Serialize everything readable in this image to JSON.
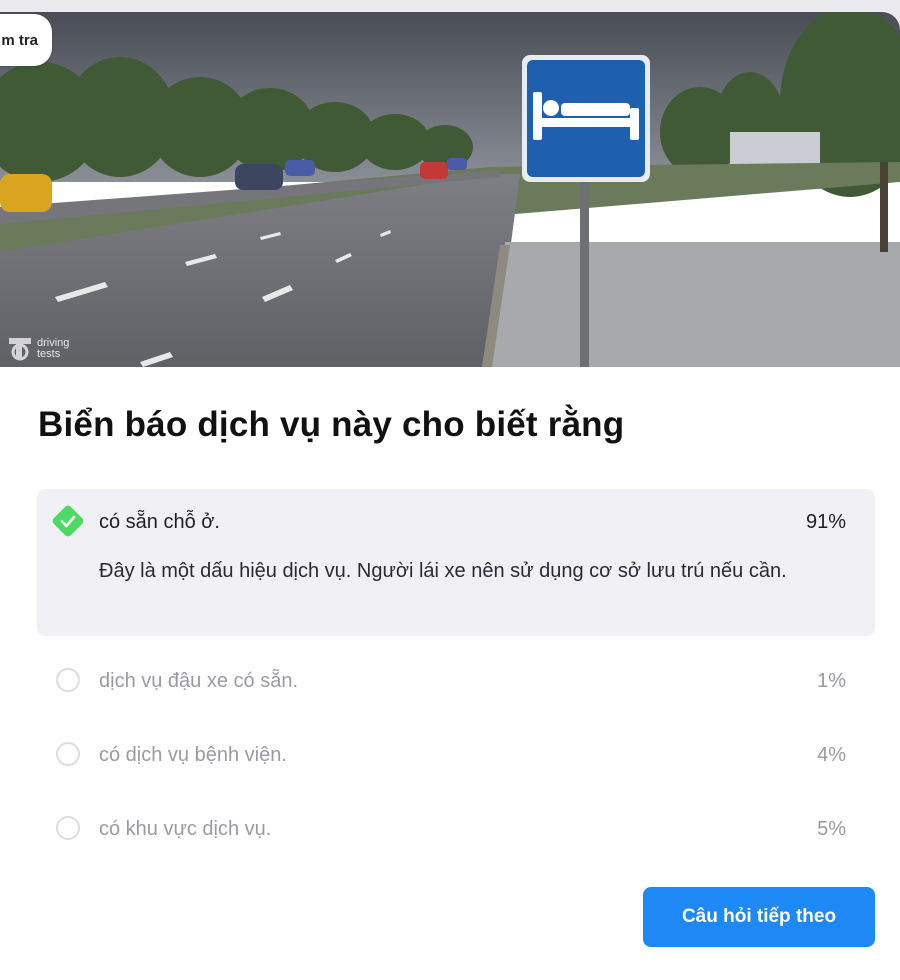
{
  "header": {
    "tab_fragment": "m tra"
  },
  "image": {
    "alt": "Hotel bed service road sign on a roadside",
    "watermark_line1": "driving",
    "watermark_line2": "tests",
    "sign_icon": "bed-icon",
    "sign_color": "#1e5fb0"
  },
  "question": {
    "text": "Biển báo dịch vụ này cho biết rằng"
  },
  "answers": [
    {
      "label": "có sẵn chỗ ở.",
      "percent": "91%",
      "correct": true,
      "explanation": "Đây là một dấu hiệu dịch vụ. Người lái xe nên sử dụng cơ sở lưu trú nếu cần."
    },
    {
      "label": "dịch vụ đậu xe có sẵn.",
      "percent": "1%",
      "correct": false
    },
    {
      "label": "có dịch vụ bệnh viện.",
      "percent": "4%",
      "correct": false
    },
    {
      "label": "có khu vực dịch vụ.",
      "percent": "5%",
      "correct": false
    }
  ],
  "colors": {
    "correct": "#4cd964",
    "accent": "#1e88f5",
    "muted": "#9a9aa3"
  },
  "actions": {
    "next_label": "Câu hỏi tiếp theo"
  }
}
